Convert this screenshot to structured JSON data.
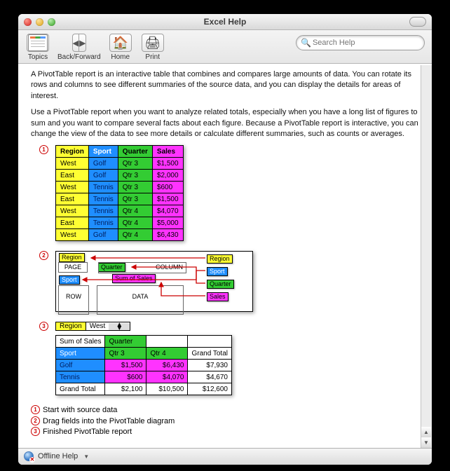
{
  "titlebar": {
    "title": "Excel Help"
  },
  "toolbar": {
    "topics": "Topics",
    "backforward": "Back/Forward",
    "home": "Home",
    "print": "Print",
    "search_placeholder": "Search Help"
  },
  "content": {
    "p1": "A PivotTable report is an interactive table that combines and compares large amounts of data. You can rotate its rows and columns to see different summaries of the source data, and you can display the details for areas of interest.",
    "p2": "Use a PivotTable report when you want to analyze related totals, especially when you have a long list of figures to sum and you want to compare several facts about each figure. Because a PivotTable report is interactive, you can change the view of the data to see more details or calculate different summaries, such as counts or averages.",
    "callouts": {
      "c1": "1",
      "c2": "2",
      "c3": "3"
    },
    "source_table": {
      "headers": [
        "Region",
        "Sport",
        "Quarter",
        "Sales"
      ],
      "rows": [
        [
          "West",
          "Golf",
          "Qtr 3",
          "$1,500"
        ],
        [
          "East",
          "Golf",
          "Qtr 3",
          "$2,000"
        ],
        [
          "West",
          "Tennis",
          "Qtr 3",
          "$600"
        ],
        [
          "East",
          "Tennis",
          "Qtr 3",
          "$1,500"
        ],
        [
          "West",
          "Tennis",
          "Qtr 4",
          "$4,070"
        ],
        [
          "East",
          "Tennis",
          "Qtr 4",
          "$5,000"
        ],
        [
          "West",
          "Golf",
          "Qtr 4",
          "$6,430"
        ]
      ]
    },
    "diagram": {
      "page": "PAGE",
      "row": "ROW",
      "column": "COLUMN",
      "data": "DATA",
      "region": "Region",
      "sport": "Sport",
      "quarter": "Quarter",
      "sales": "Sales",
      "sum": "Sum of Sales"
    },
    "pivot": {
      "region_label": "Region",
      "region_value": "West",
      "sum_label": "Sum of Sales",
      "quarter_label": "Quarter",
      "sport_label": "Sport",
      "q3": "Qtr 3",
      "q4": "Qtr 4",
      "gt": "Grand Total",
      "rows": [
        {
          "label": "Golf",
          "q3": "$1,500",
          "q4": "$6,430",
          "gt": "$7,930"
        },
        {
          "label": "Tennis",
          "q3": "$600",
          "q4": "$4,070",
          "gt": "$4,670"
        }
      ],
      "total": {
        "label": "Grand Total",
        "q3": "$2,100",
        "q4": "$10,500",
        "gt": "$12,600"
      }
    },
    "legend": {
      "l1": "Start with source data",
      "l2": "Drag fields into the PivotTable diagram",
      "l3": "Finished PivotTable report"
    }
  },
  "status": {
    "mode": "Offline Help"
  }
}
